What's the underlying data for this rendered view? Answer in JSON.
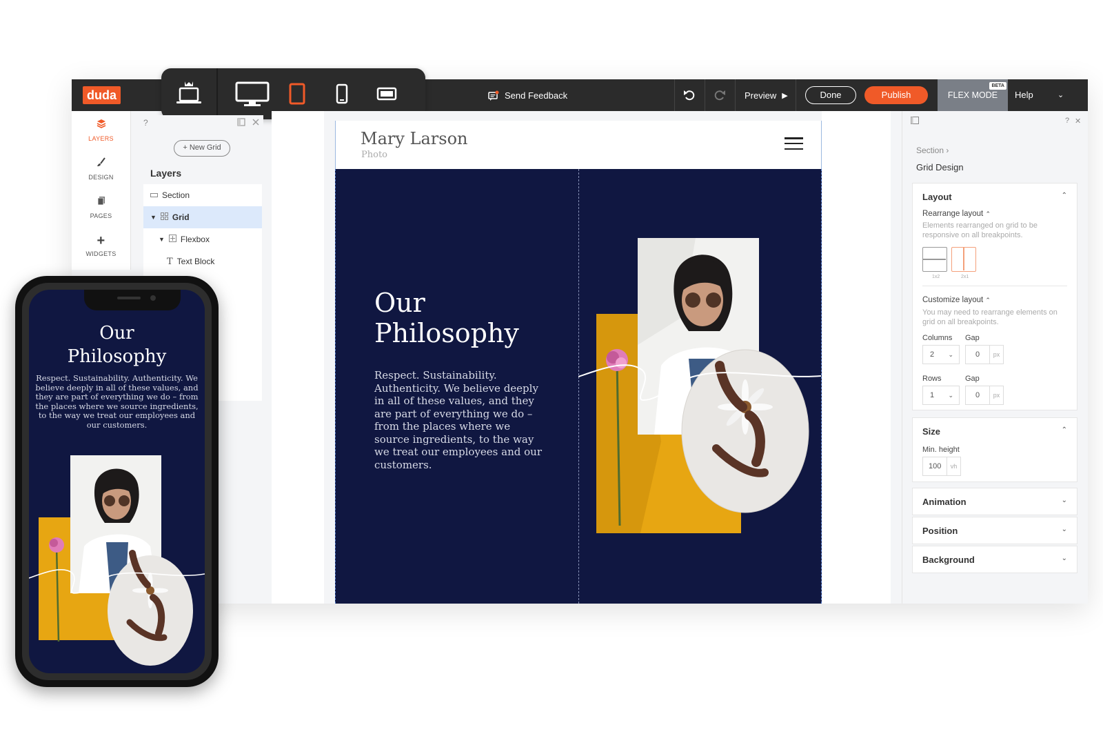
{
  "brand": {
    "logo_text": "duda",
    "accent": "#f05a28",
    "dark": "#2b2b2b",
    "site_bg": "#101741"
  },
  "toolbar": {
    "devices": [
      {
        "name": "laptop-crown-icon"
      },
      {
        "name": "desktop-icon"
      },
      {
        "name": "tablet-icon",
        "active": true
      },
      {
        "name": "mobile-icon"
      },
      {
        "name": "tablet-landscape-icon"
      }
    ],
    "send_feedback_label": "Send Feedback",
    "preview_label": "Preview",
    "done_label": "Done",
    "publish_label": "Publish",
    "flex_mode_label": "FLEX MODE",
    "beta_badge": "BETA",
    "help_label": "Help"
  },
  "rail": {
    "items": [
      {
        "label": "LAYERS",
        "icon": "layers-icon",
        "active": true
      },
      {
        "label": "DESIGN",
        "icon": "brush-icon"
      },
      {
        "label": "PAGES",
        "icon": "pages-icon"
      },
      {
        "label": "WIDGETS",
        "icon": "plus-icon"
      }
    ]
  },
  "layers_panel": {
    "help": "?",
    "new_grid_label": "New Grid",
    "title": "Layers",
    "rows": [
      {
        "label": "Section",
        "icon": "section-icon"
      },
      {
        "label": "Grid",
        "icon": "grid-icon",
        "selected": true
      },
      {
        "label": "Flexbox",
        "icon": "flexbox-icon"
      },
      {
        "label": "Text Block",
        "icon": "text-icon"
      }
    ]
  },
  "site": {
    "name": "Mary Larson",
    "subtitle": "Photo",
    "section_title": "Our Philosophy",
    "section_body": "Respect. Sustainability. Authenticity. We believe deeply in all of these values, and they are part of everything we do – from the places where we source ingredients, to the way we treat our employees and our customers."
  },
  "settings_panel": {
    "breadcrumb": "Section",
    "title": "Grid Design",
    "layout": {
      "heading": "Layout",
      "rearrange_label": "Rearrange layout",
      "rearrange_hint": "Elements rearranged on grid to be responsive on all breakpoints.",
      "options": [
        "1x2",
        "2x1"
      ],
      "customize_label": "Customize layout",
      "customize_hint": "You may need to rearrange elements on grid on all breakpoints.",
      "columns_label": "Columns",
      "columns_value": "2",
      "gap_label": "Gap",
      "column_gap": "0",
      "rows_label": "Rows",
      "rows_value": "1",
      "row_gap": "0",
      "px_unit": "px"
    },
    "size": {
      "heading": "Size",
      "min_height_label": "Min. height",
      "min_height_value": "100",
      "unit": "vh"
    },
    "animation": {
      "heading": "Animation"
    },
    "position": {
      "heading": "Position"
    },
    "background": {
      "heading": "Background"
    }
  },
  "phone": {
    "title": "Our Philosophy",
    "body": "Respect. Sustainability. Authenticity. We believe deeply in all of these values, and they are part of everything we do – from the places where we source ingredients, to the way we treat our employees and our customers."
  }
}
